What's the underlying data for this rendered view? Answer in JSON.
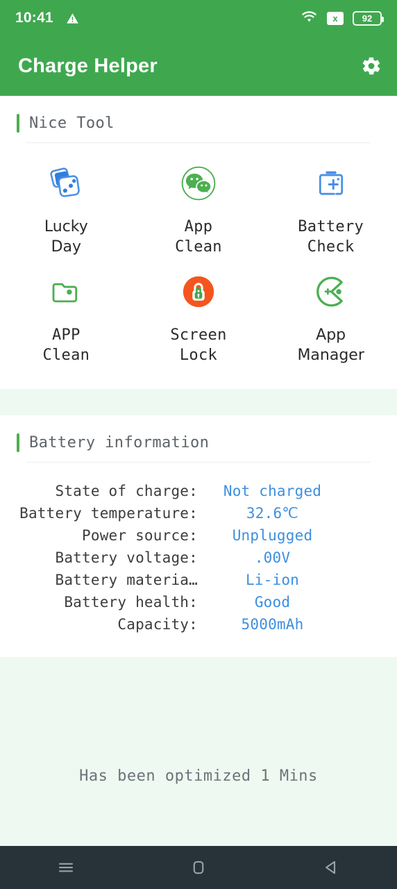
{
  "statusbar": {
    "time": "10:41",
    "warning_icon": "warning-triangle-icon",
    "wifi_icon": "wifi-icon",
    "signal_off_icon": "signal-x-icon",
    "signal_off_label": "x",
    "battery_level": "92"
  },
  "appbar": {
    "title": "Charge Helper",
    "settings_icon": "gear-icon"
  },
  "tools_section": {
    "title": "Nice Tool",
    "items": [
      {
        "label": "Lucky\nDay",
        "icon": "dice-icon",
        "color": "#2f7fe0"
      },
      {
        "label": "App\nClean",
        "icon": "chat-bubbles-icon",
        "color": "#4caf50"
      },
      {
        "label": "Battery\nCheck",
        "icon": "battery-plus-icon",
        "color": "#4a90e8"
      },
      {
        "label": "APP\nClean",
        "icon": "folder-icon",
        "color": "#4caf50"
      },
      {
        "label": "Screen\nLock",
        "icon": "lock-circle-icon",
        "color": "#f4551f"
      },
      {
        "label": "App\nManager",
        "icon": "pacman-icon",
        "color": "#4caf50"
      }
    ]
  },
  "battery_section": {
    "title": "Battery information",
    "rows": [
      {
        "label": "State of charge:",
        "value": "Not charged"
      },
      {
        "label": "Battery temperature:",
        "value": "32.6℃"
      },
      {
        "label": "Power source:",
        "value": "Unplugged"
      },
      {
        "label": "Battery voltage:",
        "value": ".00V"
      },
      {
        "label": "Battery materia…",
        "value": "Li-ion"
      },
      {
        "label": "Battery health:",
        "value": "Good"
      },
      {
        "label": "Capacity:",
        "value": "5000mAh"
      }
    ]
  },
  "footer": {
    "optimized_text": "Has been optimized 1 Mins"
  },
  "navbar": {
    "recents_icon": "menu-recents-icon",
    "home_icon": "home-square-icon",
    "back_icon": "back-triangle-icon"
  },
  "colors": {
    "brand_green": "#3fa84f",
    "accent_green": "#4caf50",
    "value_blue": "#3d8fe0",
    "page_mint": "#eef9f1",
    "nav_dark": "#283339"
  }
}
